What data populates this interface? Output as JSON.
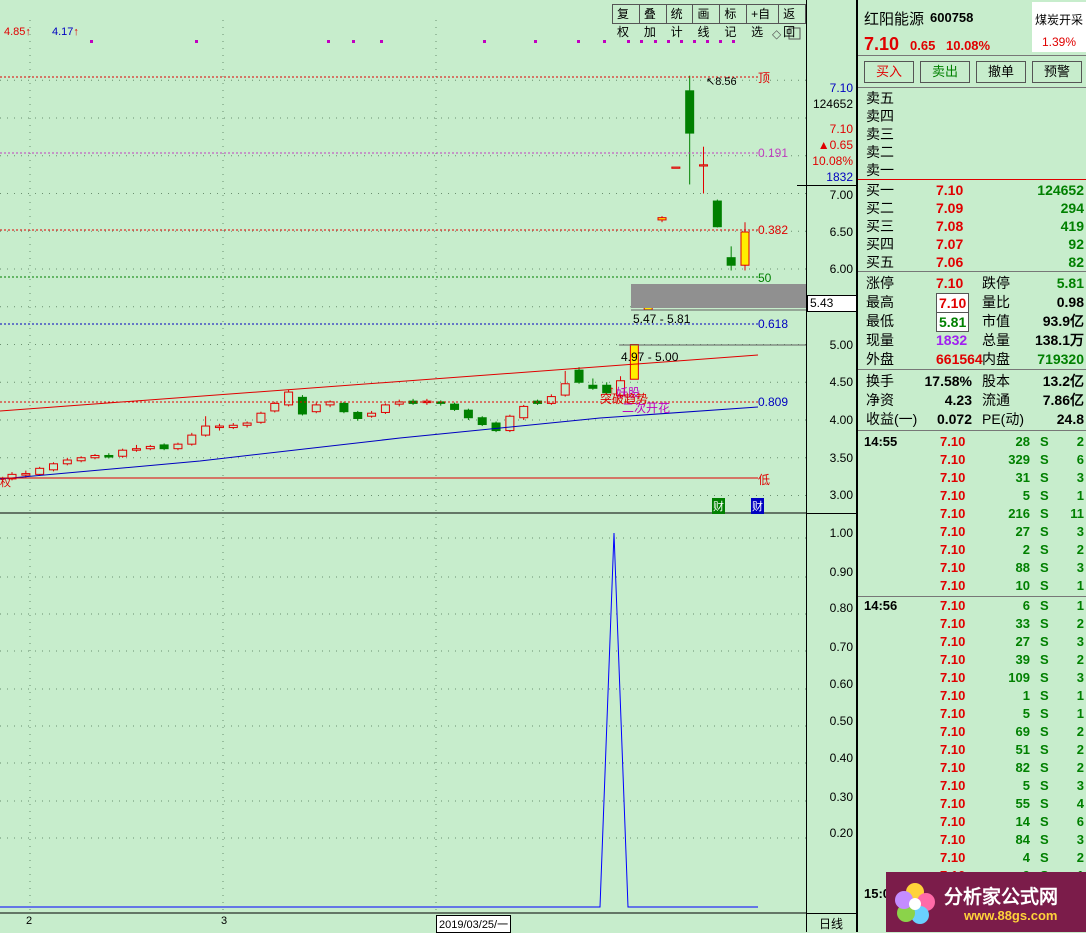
{
  "top_labels": {
    "high": "4.85",
    "low": "4.17"
  },
  "toolbar": [
    "复权",
    "叠加",
    "统计",
    "画线",
    "标记",
    "+自选",
    "返回"
  ],
  "price_axis": [
    "7.10",
    "124652",
    "7.10",
    "▲0.65",
    "10.08%",
    "1832",
    "7.00",
    "6.50",
    "6.00",
    "5.43",
    "5.00",
    "4.50",
    "4.00",
    "3.50",
    "3.00"
  ],
  "lower_axis": [
    "1.00",
    "0.90",
    "0.80",
    "0.70",
    "0.60",
    "0.50",
    "0.40",
    "0.30",
    "0.20"
  ],
  "fib": {
    "f191": "0.191",
    "f382": "0.382",
    "f50": "50",
    "f618": "0.618",
    "f809": "0.809",
    "top": "顶",
    "bottom": "低",
    "peak": "8.56"
  },
  "boxes": {
    "b1": "5.47 - 5.81",
    "b2": "4.97 - 5.00"
  },
  "annot": {
    "a1": "妖股",
    "a2": "突破趋势",
    "a3": "二次开花"
  },
  "date_axis": {
    "d1": "2",
    "d2": "3",
    "d3": "2019/03/25/一",
    "period": "日线"
  },
  "corner_tags": {
    "t1": "权",
    "t2": "财",
    "t3": "财"
  },
  "stock": {
    "name": "红阳能源",
    "code": "600758",
    "tag": "煤炭开采",
    "pct_tag": "1.39%",
    "price": "7.10",
    "chg": "0.65",
    "chg_pct": "10.08%"
  },
  "order_buttons": [
    "买入",
    "卖出",
    "撤单",
    "预警"
  ],
  "sells": [
    {
      "label": "卖五",
      "price": "",
      "vol": ""
    },
    {
      "label": "卖四",
      "price": "",
      "vol": ""
    },
    {
      "label": "卖三",
      "price": "",
      "vol": ""
    },
    {
      "label": "卖二",
      "price": "",
      "vol": ""
    },
    {
      "label": "卖一",
      "price": "",
      "vol": ""
    }
  ],
  "buys": [
    {
      "label": "买一",
      "price": "7.10",
      "vol": "124652"
    },
    {
      "label": "买二",
      "price": "7.09",
      "vol": "294"
    },
    {
      "label": "买三",
      "price": "7.08",
      "vol": "419"
    },
    {
      "label": "买四",
      "price": "7.07",
      "vol": "92"
    },
    {
      "label": "买五",
      "price": "7.06",
      "vol": "82"
    }
  ],
  "stats1": [
    {
      "k1": "涨停",
      "v1": "7.10",
      "k2": "跌停",
      "v2": "5.81"
    },
    {
      "k1": "最高",
      "v1": "7.10",
      "k2": "量比",
      "v2": "0.98"
    },
    {
      "k1": "最低",
      "v1": "5.81",
      "k2": "市值",
      "v2": "93.9亿"
    },
    {
      "k1": "现量",
      "v1": "1832",
      "k2": "总量",
      "v2": "138.1万"
    },
    {
      "k1": "外盘",
      "v1": "661564",
      "k2": "内盘",
      "v2": "719320"
    }
  ],
  "stats2": [
    {
      "k1": "换手",
      "v1": "17.58%",
      "k2": "股本",
      "v2": "13.2亿"
    },
    {
      "k1": "净资",
      "v1": "4.23",
      "k2": "流通",
      "v2": "7.86亿"
    },
    {
      "k1": "收益(一)",
      "v1": "0.072",
      "k2": "PE(动)",
      "v2": "24.8"
    }
  ],
  "ticks": [
    {
      "t": "14:55",
      "p": "7.10",
      "v": "28",
      "s": "S",
      "n": "2"
    },
    {
      "t": "",
      "p": "7.10",
      "v": "329",
      "s": "S",
      "n": "6"
    },
    {
      "t": "",
      "p": "7.10",
      "v": "31",
      "s": "S",
      "n": "3"
    },
    {
      "t": "",
      "p": "7.10",
      "v": "5",
      "s": "S",
      "n": "1"
    },
    {
      "t": "",
      "p": "7.10",
      "v": "216",
      "s": "S",
      "n": "11"
    },
    {
      "t": "",
      "p": "7.10",
      "v": "27",
      "s": "S",
      "n": "3"
    },
    {
      "t": "",
      "p": "7.10",
      "v": "2",
      "s": "S",
      "n": "2"
    },
    {
      "t": "",
      "p": "7.10",
      "v": "88",
      "s": "S",
      "n": "3"
    },
    {
      "t": "",
      "p": "7.10",
      "v": "10",
      "s": "S",
      "n": "1"
    },
    {
      "t": "14:56",
      "p": "7.10",
      "v": "6",
      "s": "S",
      "n": "1"
    },
    {
      "t": "",
      "p": "7.10",
      "v": "33",
      "s": "S",
      "n": "2"
    },
    {
      "t": "",
      "p": "7.10",
      "v": "27",
      "s": "S",
      "n": "3"
    },
    {
      "t": "",
      "p": "7.10",
      "v": "39",
      "s": "S",
      "n": "2"
    },
    {
      "t": "",
      "p": "7.10",
      "v": "109",
      "s": "S",
      "n": "3"
    },
    {
      "t": "",
      "p": "7.10",
      "v": "1",
      "s": "S",
      "n": "1"
    },
    {
      "t": "",
      "p": "7.10",
      "v": "5",
      "s": "S",
      "n": "1"
    },
    {
      "t": "",
      "p": "7.10",
      "v": "69",
      "s": "S",
      "n": "2"
    },
    {
      "t": "",
      "p": "7.10",
      "v": "51",
      "s": "S",
      "n": "2"
    },
    {
      "t": "",
      "p": "7.10",
      "v": "82",
      "s": "S",
      "n": "2"
    },
    {
      "t": "",
      "p": "7.10",
      "v": "5",
      "s": "S",
      "n": "3"
    },
    {
      "t": "",
      "p": "7.10",
      "v": "55",
      "s": "S",
      "n": "4"
    },
    {
      "t": "",
      "p": "7.10",
      "v": "14",
      "s": "S",
      "n": "6"
    },
    {
      "t": "",
      "p": "7.10",
      "v": "84",
      "s": "S",
      "n": "3"
    },
    {
      "t": "",
      "p": "7.10",
      "v": "4",
      "s": "S",
      "n": "2"
    },
    {
      "t": "",
      "p": "7.10",
      "v": "9",
      "s": "S",
      "n": "1"
    },
    {
      "t": "15:00",
      "p": "",
      "v": "",
      "s": "",
      "n": ""
    }
  ],
  "logo": {
    "text": "分析家公式网",
    "url": "www.88gs.com"
  },
  "colors": {
    "bg": "#c7edcc",
    "up": "#e00000",
    "down": "#008000",
    "yellow": "#ffee00"
  },
  "candles": [
    {
      "o": 3.22,
      "c": 3.28,
      "h": 3.31,
      "l": 3.2
    },
    {
      "o": 3.27,
      "c": 3.29,
      "h": 3.33,
      "l": 3.24
    },
    {
      "o": 3.28,
      "c": 3.36,
      "h": 3.38,
      "l": 3.26
    },
    {
      "o": 3.34,
      "c": 3.42,
      "h": 3.44,
      "l": 3.32
    },
    {
      "o": 3.42,
      "c": 3.47,
      "h": 3.5,
      "l": 3.4
    },
    {
      "o": 3.46,
      "c": 3.5,
      "h": 3.52,
      "l": 3.44
    },
    {
      "o": 3.5,
      "c": 3.53,
      "h": 3.55,
      "l": 3.48
    },
    {
      "o": 3.53,
      "c": 3.51,
      "h": 3.56,
      "l": 3.49
    },
    {
      "o": 3.52,
      "c": 3.6,
      "h": 3.62,
      "l": 3.5
    },
    {
      "o": 3.6,
      "c": 3.62,
      "h": 3.67,
      "l": 3.58
    },
    {
      "o": 3.62,
      "c": 3.65,
      "h": 3.67,
      "l": 3.6
    },
    {
      "o": 3.67,
      "c": 3.62,
      "h": 3.69,
      "l": 3.6
    },
    {
      "o": 3.62,
      "c": 3.68,
      "h": 3.7,
      "l": 3.6
    },
    {
      "o": 3.68,
      "c": 3.8,
      "h": 3.83,
      "l": 3.66
    },
    {
      "o": 3.8,
      "c": 3.92,
      "h": 4.05,
      "l": 3.78
    },
    {
      "o": 3.9,
      "c": 3.92,
      "h": 3.95,
      "l": 3.86
    },
    {
      "o": 3.9,
      "c": 3.93,
      "h": 3.96,
      "l": 3.88
    },
    {
      "o": 3.93,
      "c": 3.96,
      "h": 3.98,
      "l": 3.9
    },
    {
      "o": 3.97,
      "c": 4.09,
      "h": 4.11,
      "l": 3.95
    },
    {
      "o": 4.12,
      "c": 4.22,
      "h": 4.24,
      "l": 4.1
    },
    {
      "o": 4.2,
      "c": 4.37,
      "h": 4.4,
      "l": 4.18
    },
    {
      "o": 4.3,
      "c": 4.08,
      "h": 4.33,
      "l": 4.06
    },
    {
      "o": 4.11,
      "c": 4.2,
      "h": 4.23,
      "l": 4.09
    },
    {
      "o": 4.2,
      "c": 4.24,
      "h": 4.26,
      "l": 4.17
    },
    {
      "o": 4.22,
      "c": 4.11,
      "h": 4.24,
      "l": 4.09
    },
    {
      "o": 4.1,
      "c": 4.02,
      "h": 4.12,
      "l": 3.99
    },
    {
      "o": 4.05,
      "c": 4.09,
      "h": 4.12,
      "l": 4.03
    },
    {
      "o": 4.1,
      "c": 4.2,
      "h": 4.22,
      "l": 4.08
    },
    {
      "o": 4.21,
      "c": 4.24,
      "h": 4.27,
      "l": 4.18
    },
    {
      "o": 4.25,
      "c": 4.22,
      "h": 4.28,
      "l": 4.2
    },
    {
      "o": 4.23,
      "c": 4.25,
      "h": 4.28,
      "l": 4.2
    },
    {
      "o": 4.24,
      "c": 4.22,
      "h": 4.26,
      "l": 4.19
    },
    {
      "o": 4.21,
      "c": 4.14,
      "h": 4.23,
      "l": 4.12
    },
    {
      "o": 4.13,
      "c": 4.03,
      "h": 4.15,
      "l": 4.0
    },
    {
      "o": 4.03,
      "c": 3.94,
      "h": 4.05,
      "l": 3.92
    },
    {
      "o": 3.96,
      "c": 3.86,
      "h": 3.98,
      "l": 3.84
    },
    {
      "o": 3.86,
      "c": 4.05,
      "h": 4.07,
      "l": 3.84
    },
    {
      "o": 4.03,
      "c": 4.18,
      "h": 4.2,
      "l": 4.0
    },
    {
      "o": 4.25,
      "c": 4.22,
      "h": 4.27,
      "l": 4.2
    },
    {
      "o": 4.22,
      "c": 4.31,
      "h": 4.34,
      "l": 4.2
    },
    {
      "o": 4.33,
      "c": 4.48,
      "h": 4.65,
      "l": 4.31
    },
    {
      "o": 4.66,
      "c": 4.5,
      "h": 4.7,
      "l": 4.48
    },
    {
      "o": 4.46,
      "c": 4.42,
      "h": 4.55,
      "l": 4.4
    },
    {
      "o": 4.46,
      "c": 4.36,
      "h": 4.5,
      "l": 4.33
    },
    {
      "o": 4.32,
      "c": 4.52,
      "h": 4.58,
      "l": 4.3
    },
    {
      "o": 4.54,
      "c": 5.0,
      "h": 5.0,
      "l": 4.54
    },
    {
      "o": 5.46,
      "c": 5.5,
      "h": 5.5,
      "l": 5.45
    },
    {
      "o": 6.65,
      "c": 6.68,
      "h": 6.7,
      "l": 6.62
    },
    {
      "o": 7.35,
      "c": 7.35,
      "h": 7.35,
      "l": 7.35
    },
    {
      "o": 8.36,
      "c": 7.8,
      "h": 8.56,
      "l": 7.12
    },
    {
      "o": 7.38,
      "c": 7.38,
      "h": 7.62,
      "l": 7.0
    },
    {
      "o": 6.9,
      "c": 6.56,
      "h": 6.92,
      "l": 6.55
    },
    {
      "o": 6.15,
      "c": 6.05,
      "h": 6.3,
      "l": 5.98
    },
    {
      "o": 6.05,
      "c": 6.49,
      "h": 6.62,
      "l": 5.98
    }
  ]
}
